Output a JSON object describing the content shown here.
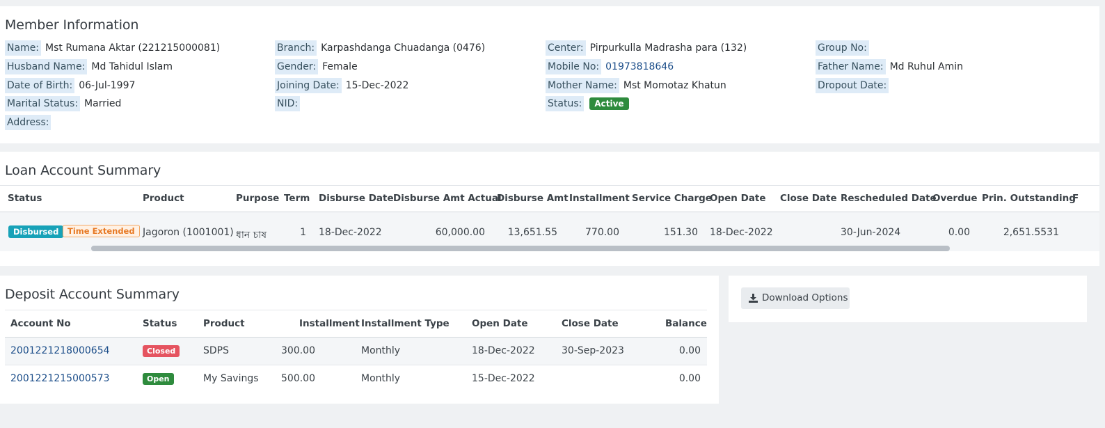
{
  "member": {
    "title": "Member Information",
    "fields": {
      "name": {
        "label": "Name:",
        "value": "Mst Rumana Aktar (221215000081)"
      },
      "branch": {
        "label": "Branch:",
        "value": "Karpashdanga Chuadanga (0476)"
      },
      "center": {
        "label": "Center:",
        "value": "Pirpurkulla Madrasha para (132)"
      },
      "group": {
        "label": "Group No:",
        "value": ""
      },
      "husband": {
        "label": "Husband Name:",
        "value": "Md Tahidul Islam"
      },
      "gender": {
        "label": "Gender:",
        "value": "Female"
      },
      "mobile": {
        "label": "Mobile No:",
        "value": "01973818646"
      },
      "father": {
        "label": "Father Name:",
        "value": "Md Ruhul Amin"
      },
      "dob": {
        "label": "Date of Birth:",
        "value": "06-Jul-1997"
      },
      "joining": {
        "label": "Joining Date:",
        "value": "15-Dec-2022"
      },
      "mother": {
        "label": "Mother Name:",
        "value": "Mst Momotaz Khatun"
      },
      "dropout": {
        "label": "Dropout Date:",
        "value": ""
      },
      "marital": {
        "label": "Marital Status:",
        "value": "Married"
      },
      "nid": {
        "label": "NID:",
        "value": ""
      },
      "status": {
        "label": "Status:",
        "value": "Active"
      },
      "address": {
        "label": "Address:",
        "value": ""
      }
    }
  },
  "loan": {
    "title": "Loan Account Summary",
    "headers": {
      "status": "Status",
      "product": "Product",
      "purpose": "Purpose",
      "term": "Term",
      "disburse_date": "Disburse Date",
      "disburse_amt_actual": "Disburse Amt Actual",
      "disburse_amt": "Disburse Amt",
      "installment": "Installment",
      "service_charge": "Service Charge",
      "open_date": "Open Date",
      "close_date": "Close Date",
      "rescheduled_date": "Rescheduled Date",
      "overdue": "Overdue",
      "prin_outstanding": "Prin. Outstanding",
      "next_cut": "F"
    },
    "row": {
      "badge_status": "Disbursed",
      "badge_extended": "Time Extended",
      "product": "Jagoron (1001001)",
      "purpose": "ধান চাষ",
      "term": "1",
      "disburse_date": "18-Dec-2022",
      "disburse_amt_actual": "60,000.00",
      "disburse_amt": "13,651.55",
      "installment": "770.00",
      "service_charge": "151.30",
      "open_date": "18-Dec-2022",
      "close_date": "",
      "rescheduled_date": "30-Jun-2024",
      "overdue": "0.00",
      "prin_outstanding": "2,651.5531"
    }
  },
  "deposit": {
    "title": "Deposit Account Summary",
    "headers": {
      "account_no": "Account No",
      "status": "Status",
      "product": "Product",
      "installment": "Installment",
      "installment_type": "Installment Type",
      "open_date": "Open Date",
      "close_date": "Close Date",
      "balance": "Balance"
    },
    "rows": [
      {
        "account_no": "2001221218000654",
        "status": "Closed",
        "product": "SDPS",
        "installment": "300.00",
        "installment_type": "Monthly",
        "open_date": "18-Dec-2022",
        "close_date": "30-Sep-2023",
        "balance": "0.00"
      },
      {
        "account_no": "2001221215000573",
        "status": "Open",
        "product": "My Savings",
        "installment": "500.00",
        "installment_type": "Monthly",
        "open_date": "15-Dec-2022",
        "close_date": "",
        "balance": "0.00"
      }
    ]
  },
  "download": {
    "label": "Download Options",
    "icon": "download-icon"
  }
}
